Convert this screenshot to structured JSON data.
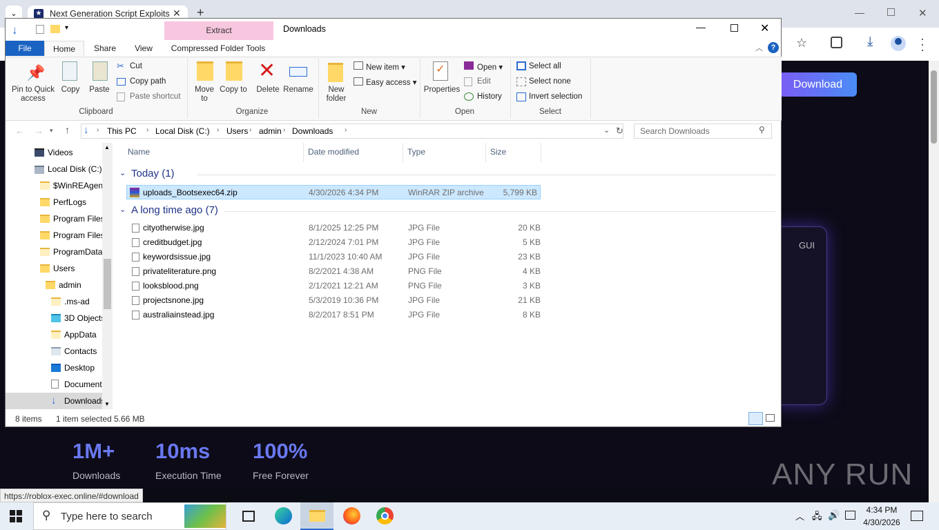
{
  "browser": {
    "tab_title": "Next Generation Script Exploits",
    "status_url": "https://roblox-exec.online/#download"
  },
  "web": {
    "download_button": "Download",
    "gui_label": "GUI",
    "stats": [
      {
        "value": "1M+",
        "label": "Downloads"
      },
      {
        "value": "10ms",
        "label": "Execution Time"
      },
      {
        "value": "100%",
        "label": "Free Forever"
      }
    ],
    "watermark": "ANY RUN"
  },
  "explorer": {
    "title": "Downloads",
    "context_tab": "Extract",
    "tabs": [
      "File",
      "Home",
      "Share",
      "View",
      "Compressed Folder Tools"
    ],
    "ribbon": {
      "clipboard": {
        "pin": "Pin to Quick access",
        "copy": "Copy",
        "paste": "Paste",
        "cut": "Cut",
        "copy_path": "Copy path",
        "paste_shortcut": "Paste shortcut",
        "label": "Clipboard"
      },
      "organize": {
        "move_to": "Move to",
        "copy_to": "Copy to",
        "delete": "Delete",
        "rename": "Rename",
        "label": "Organize"
      },
      "new": {
        "new_folder": "New folder",
        "new_item": "New item",
        "easy_access": "Easy access",
        "label": "New"
      },
      "open": {
        "properties": "Properties",
        "open": "Open",
        "edit": "Edit",
        "history": "History",
        "label": "Open"
      },
      "select": {
        "select_all": "Select all",
        "select_none": "Select none",
        "invert": "Invert selection",
        "label": "Select"
      }
    },
    "address": [
      "This PC",
      "Local Disk (C:)",
      "Users",
      "admin",
      "Downloads"
    ],
    "search_placeholder": "Search Downloads",
    "nav": [
      "Videos",
      "Local Disk (C:)",
      "$WinREAgent",
      "PerfLogs",
      "Program Files",
      "Program Files",
      "ProgramData",
      "Users",
      "admin",
      ".ms-ad",
      "3D Objects",
      "AppData",
      "Contacts",
      "Desktop",
      "Documents",
      "Downloads"
    ],
    "columns": [
      "Name",
      "Date modified",
      "Type",
      "Size"
    ],
    "groups": [
      "Today (1)",
      "A long time ago (7)"
    ],
    "today_files": [
      {
        "name": "uploads_Bootsexec64.zip",
        "date": "4/30/2026 4:34 PM",
        "type": "WinRAR ZIP archive",
        "size": "5,799 KB"
      }
    ],
    "old_files": [
      {
        "name": "cityotherwise.jpg",
        "date": "8/1/2025 12:25 PM",
        "type": "JPG File",
        "size": "20 KB"
      },
      {
        "name": "creditbudget.jpg",
        "date": "2/12/2024 7:01 PM",
        "type": "JPG File",
        "size": "5 KB"
      },
      {
        "name": "keywordsissue.jpg",
        "date": "11/1/2023 10:40 AM",
        "type": "JPG File",
        "size": "23 KB"
      },
      {
        "name": "privateliterature.png",
        "date": "8/2/2021 4:38 AM",
        "type": "PNG File",
        "size": "4 KB"
      },
      {
        "name": "looksblood.png",
        "date": "2/1/2021 12:21 AM",
        "type": "PNG File",
        "size": "3 KB"
      },
      {
        "name": "projectsnone.jpg",
        "date": "5/3/2019 10:36 PM",
        "type": "JPG File",
        "size": "21 KB"
      },
      {
        "name": "australiainstead.jpg",
        "date": "8/2/2017 8:51 PM",
        "type": "JPG File",
        "size": "8 KB"
      }
    ],
    "status": {
      "items": "8 items",
      "selected": "1 item selected",
      "size": "5.66 MB"
    }
  },
  "taskbar": {
    "search_placeholder": "Type here to search",
    "time": "4:34 PM",
    "date": "4/30/2026"
  }
}
